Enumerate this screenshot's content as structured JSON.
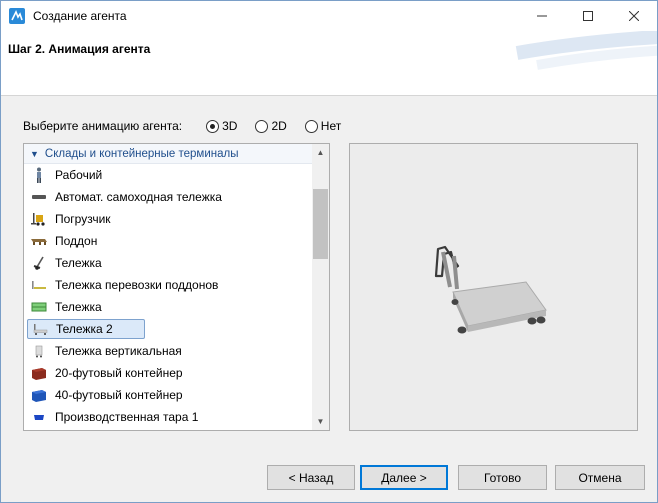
{
  "window": {
    "title": "Создание агента"
  },
  "header": {
    "title": "Шаг 2. Анимация агента"
  },
  "animation": {
    "prompt": "Выберите анимацию агента:",
    "options": [
      {
        "label": "3D",
        "selected": true
      },
      {
        "label": "2D",
        "selected": false
      },
      {
        "label": "Нет",
        "selected": false
      }
    ]
  },
  "list": {
    "group": "Склады и контейнерные терминалы",
    "items": [
      {
        "label": "Рабочий",
        "icon": "worker-icon",
        "selected": false
      },
      {
        "label": "Автомат. самоходная тележка",
        "icon": "agv-icon",
        "selected": false
      },
      {
        "label": "Погрузчик",
        "icon": "forklift-icon",
        "selected": false
      },
      {
        "label": "Поддон",
        "icon": "pallet-icon",
        "selected": false
      },
      {
        "label": "Тележка",
        "icon": "hand-truck-icon",
        "selected": false
      },
      {
        "label": "Тележка перевозки поддонов",
        "icon": "pallet-jack-icon",
        "selected": false
      },
      {
        "label": "Тележка",
        "icon": "cart-green-icon",
        "selected": false
      },
      {
        "label": "Тележка 2",
        "icon": "cart-icon",
        "selected": true
      },
      {
        "label": "Тележка вертикальная",
        "icon": "vertical-cart-icon",
        "selected": false
      },
      {
        "label": "20-футовый контейнер",
        "icon": "container-20-icon",
        "selected": false
      },
      {
        "label": "40-футовый контейнер",
        "icon": "container-40-icon",
        "selected": false
      },
      {
        "label": "Производственная тара 1",
        "icon": "tote-icon",
        "selected": false
      }
    ]
  },
  "buttons": {
    "back": "< Назад",
    "next": "Далее >",
    "done": "Готово",
    "cancel": "Отмена"
  },
  "colors": {
    "accent": "#0078d7",
    "selection": "#dbe9f9",
    "group_text": "#1f4e8c"
  }
}
